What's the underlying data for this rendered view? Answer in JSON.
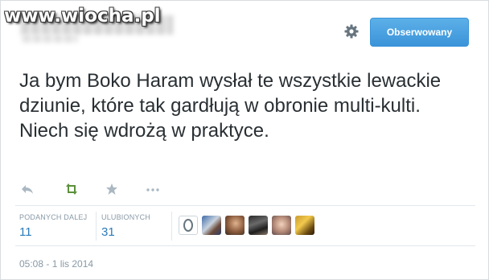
{
  "watermark": "www.wiocha.pl",
  "header": {
    "follow_label": "Obserwowany",
    "settings_icon": "gear-icon"
  },
  "tweet": {
    "text": "Ja bym Boko Haram wysłał te wszystkie lewackie dziunie, które tak gardłują w obronie multi-kulti. Niech się wdrożą w praktyce.",
    "timestamp": "05:08 - 1 lis 2014"
  },
  "actions": [
    {
      "name": "reply-icon",
      "color": "#aab8c2"
    },
    {
      "name": "retweet-icon",
      "color": "#5c913b"
    },
    {
      "name": "favorite-icon",
      "color": "#aab8c2"
    },
    {
      "name": "more-icon",
      "color": "#aab8c2"
    }
  ],
  "stats": {
    "retweets_label": "PODANYCH DALEJ",
    "retweets_value": "11",
    "favorites_label": "ULUBIONYCH",
    "favorites_value": "31"
  },
  "colors": {
    "accent": "#3b94d9",
    "link": "#2b7bb9",
    "muted": "#8899a6",
    "text": "#292f33"
  }
}
